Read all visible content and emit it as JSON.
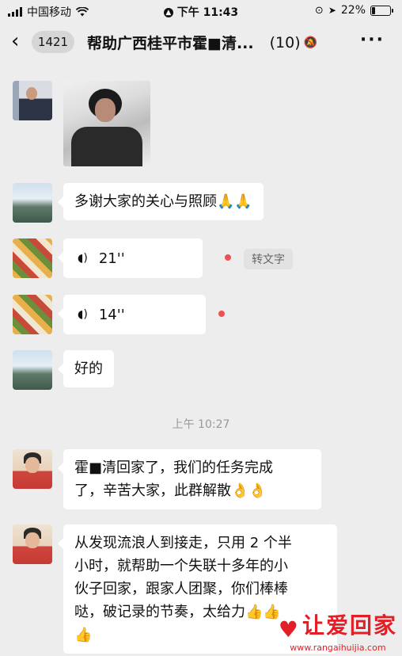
{
  "status": {
    "carrier": "中国移动",
    "time": "下午 11:43",
    "battery": "22%",
    "battery_level": 0.22
  },
  "nav": {
    "back_icon": "chevron-left-icon",
    "unread_count": "1421",
    "title": "帮助广西桂平市霍■清...",
    "member_count": "(10)",
    "more_icon": "more-dots-icon"
  },
  "messages": [
    {
      "type": "image"
    },
    {
      "type": "text",
      "text": "多谢大家的关心与照顾🙏🙏"
    },
    {
      "type": "voice",
      "duration": "21''",
      "unread": true,
      "action": "转文字"
    },
    {
      "type": "voice",
      "duration": "14''",
      "unread": true
    },
    {
      "type": "text",
      "text": "好的"
    }
  ],
  "timestamp": "上午 10:27",
  "later_messages": [
    {
      "type": "text",
      "lines": [
        "霍■清回家了，我们的任务完成",
        "了，辛苦大家，此群解散👌👌"
      ]
    },
    {
      "type": "text",
      "lines": [
        "从发现流浪人到接走，只用 2 个半",
        "小时，就帮助一个失联十多年的小",
        "伙子回家，跟家人团聚，你们棒棒",
        "哒，破记录的节奏，太给力👍👍",
        "👍"
      ]
    }
  ],
  "watermark": {
    "brand": "让爱回家",
    "url": "www.rangaihuijia.com"
  },
  "colors": {
    "background": "#ededed",
    "bubble": "#ffffff",
    "unread_dot": "#f05050",
    "watermark": "#e21f26"
  }
}
